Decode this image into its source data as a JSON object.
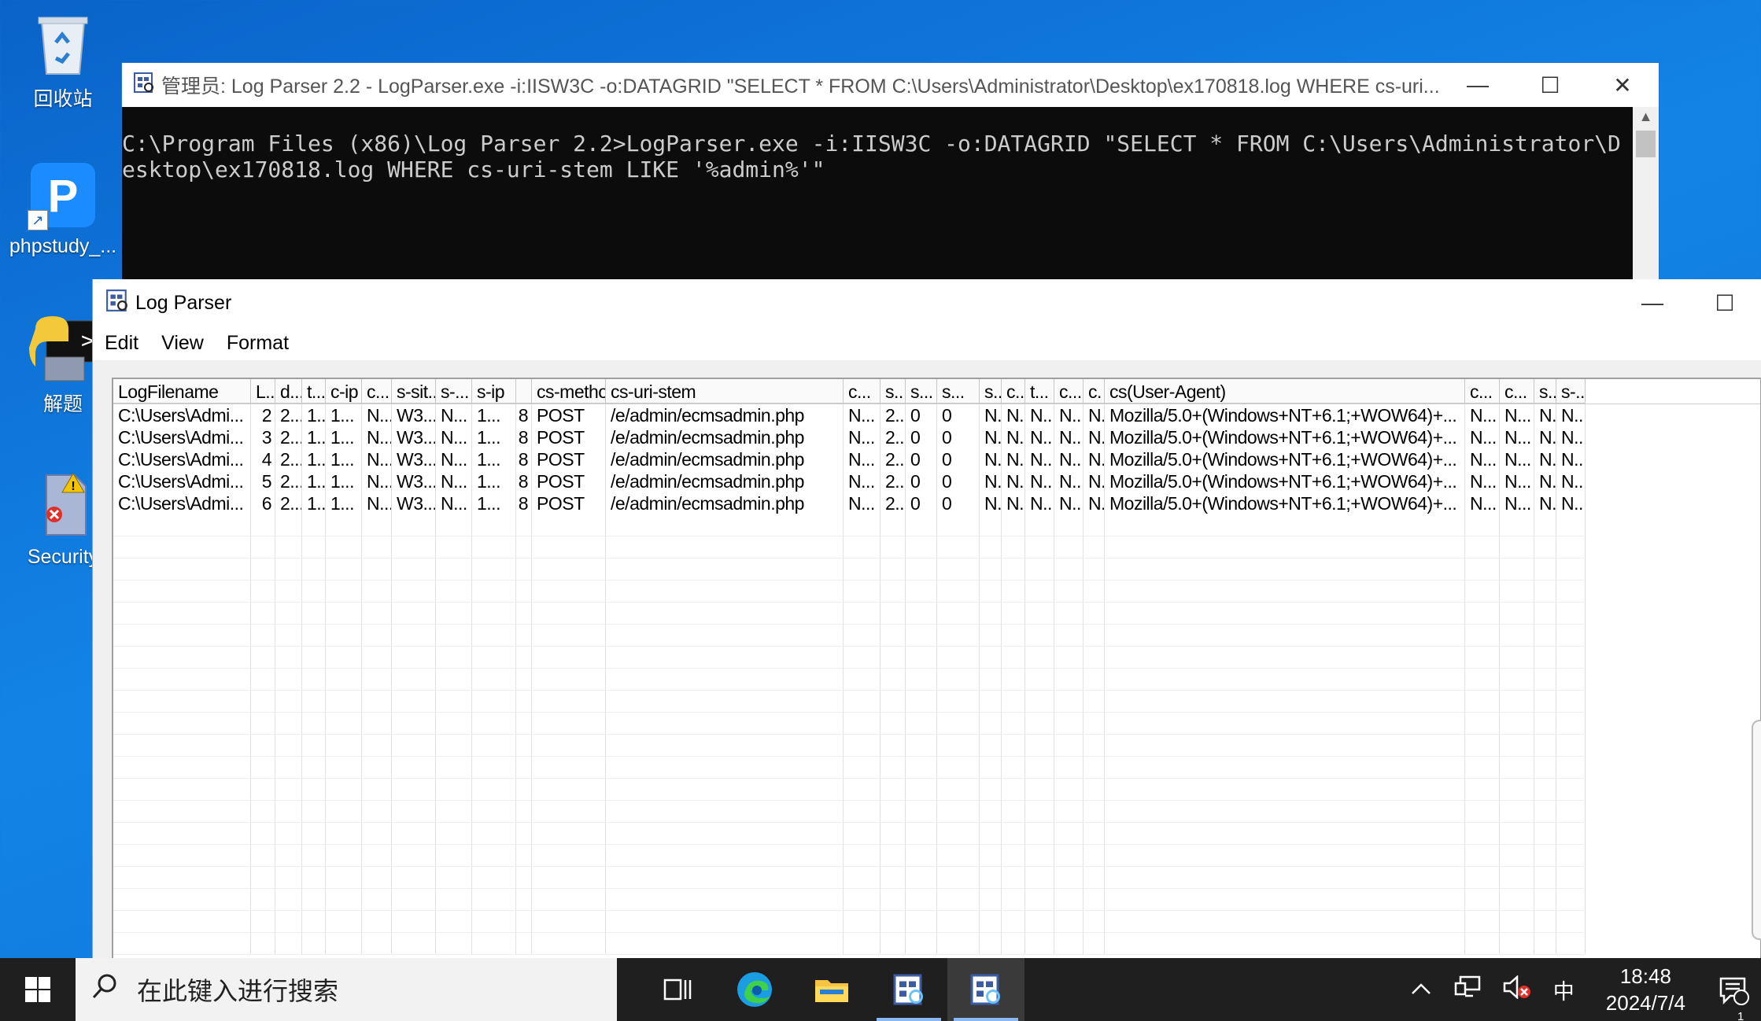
{
  "desktop": {
    "icons": [
      {
        "label": "回收站",
        "icon": "recycle-bin-icon"
      },
      {
        "label": "phpstudy_...",
        "icon": "phpstudy-icon"
      },
      {
        "label": "解题",
        "icon": "python-script-icon"
      },
      {
        "label": "Security",
        "icon": "security-file-icon"
      }
    ]
  },
  "console": {
    "title": "管理员: Log Parser 2.2 - LogParser.exe  -i:IISW3C -o:DATAGRID \"SELECT * FROM C:\\Users\\Administrator\\Desktop\\ex170818.log WHERE cs-uri...",
    "command": "C:\\Program Files (x86)\\Log Parser 2.2>LogParser.exe -i:IISW3C -o:DATAGRID \"SELECT * FROM C:\\Users\\Administrator\\Desktop\\ex170818.log WHERE cs-uri-stem LIKE '%admin%'\"",
    "minimize": "—",
    "maximize": "☐",
    "close": "✕"
  },
  "logparser": {
    "title": "Log Parser",
    "minimize": "—",
    "maximize": "☐",
    "menu": [
      "Edit",
      "View",
      "Format"
    ],
    "columns": [
      "LogFilename",
      "L..",
      "d...",
      "t...",
      "c-ip",
      "c...",
      "s-sit...",
      "s-...",
      "s-ip",
      "",
      "cs-method",
      "cs-uri-stem",
      "c...",
      "s..",
      "s...",
      "s...",
      "s..",
      "c..",
      "t...",
      "c...",
      "c.",
      "cs(User-Agent)",
      "c...",
      "c...",
      "s..",
      "s-..."
    ],
    "rows": [
      [
        "C:\\Users\\Admi...",
        "2",
        "2...",
        "1...",
        "1...",
        "N...",
        "W3...",
        "N...",
        "1...",
        "8",
        "POST",
        "/e/admin/ecmsadmin.php",
        "N...",
        "2..",
        "0",
        "0",
        "N..",
        "N..",
        "N...",
        "N...",
        "N..",
        "Mozilla/5.0+(Windows+NT+6.1;+WOW64)+...",
        "N...",
        "N...",
        "N..",
        "N..."
      ],
      [
        "C:\\Users\\Admi...",
        "3",
        "2...",
        "1...",
        "1...",
        "N...",
        "W3...",
        "N...",
        "1...",
        "8",
        "POST",
        "/e/admin/ecmsadmin.php",
        "N...",
        "2..",
        "0",
        "0",
        "N..",
        "N..",
        "N...",
        "N...",
        "N..",
        "Mozilla/5.0+(Windows+NT+6.1;+WOW64)+...",
        "N...",
        "N...",
        "N..",
        "N..."
      ],
      [
        "C:\\Users\\Admi...",
        "4",
        "2...",
        "1...",
        "1...",
        "N...",
        "W3...",
        "N...",
        "1...",
        "8",
        "POST",
        "/e/admin/ecmsadmin.php",
        "N...",
        "2..",
        "0",
        "0",
        "N..",
        "N..",
        "N...",
        "N...",
        "N..",
        "Mozilla/5.0+(Windows+NT+6.1;+WOW64)+...",
        "N...",
        "N...",
        "N..",
        "N..."
      ],
      [
        "C:\\Users\\Admi...",
        "5",
        "2...",
        "1...",
        "1...",
        "N...",
        "W3...",
        "N...",
        "1...",
        "8",
        "POST",
        "/e/admin/ecmsadmin.php",
        "N...",
        "2..",
        "0",
        "0",
        "N..",
        "N..",
        "N...",
        "N...",
        "N..",
        "Mozilla/5.0+(Windows+NT+6.1;+WOW64)+...",
        "N...",
        "N...",
        "N..",
        "N..."
      ],
      [
        "C:\\Users\\Admi...",
        "6",
        "2...",
        "1...",
        "1...",
        "N...",
        "W3...",
        "N...",
        "1...",
        "8",
        "POST",
        "/e/admin/ecmsadmin.php",
        "N...",
        "2..",
        "0",
        "0",
        "N..",
        "N..",
        "N...",
        "N...",
        "N..",
        "Mozilla/5.0+(Windows+NT+6.1;+WOW64)+...",
        "N...",
        "N...",
        "N..",
        "N..."
      ]
    ]
  },
  "taskbar": {
    "search_placeholder": "在此键入进行搜索",
    "apps": [
      "task-view-icon",
      "edge-icon",
      "file-explorer-icon",
      "logparser-icon",
      "logparser-icon"
    ],
    "ime": "中",
    "time": "18:48",
    "date": "2024/7/4",
    "notification_count": "1"
  },
  "colors": {
    "desktop_accent": "#1384e6",
    "console_bg": "#0c0c0c",
    "console_text": "#cccccc",
    "taskbar_bg": "#1f1f1f"
  }
}
